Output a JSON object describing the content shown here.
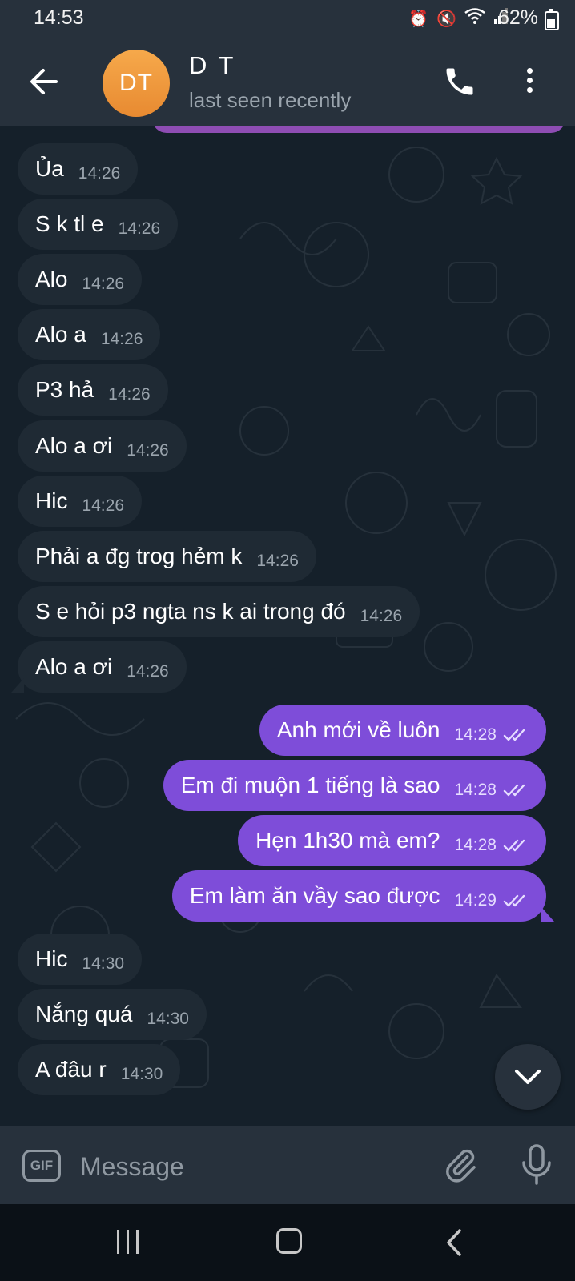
{
  "status_bar": {
    "time": "14:53",
    "battery": "62%"
  },
  "header": {
    "avatar_initials": "DT",
    "contact_name": "D T",
    "status": "last seen recently"
  },
  "messages": [
    {
      "dir": "in",
      "text": "Ủa",
      "time": "14:26"
    },
    {
      "dir": "in",
      "text": "S k tl e",
      "time": "14:26"
    },
    {
      "dir": "in",
      "text": "Alo",
      "time": "14:26"
    },
    {
      "dir": "in",
      "text": "Alo a",
      "time": "14:26"
    },
    {
      "dir": "in",
      "text": "P3 hả",
      "time": "14:26"
    },
    {
      "dir": "in",
      "text": "Alo a ơi",
      "time": "14:26"
    },
    {
      "dir": "in",
      "text": "Hic",
      "time": "14:26"
    },
    {
      "dir": "in",
      "text": "Phải a đg trog hẻm k",
      "time": "14:26"
    },
    {
      "dir": "in",
      "text": "S e hỏi p3 ngta ns k ai trong đó",
      "time": "14:26"
    },
    {
      "dir": "in",
      "text": "Alo a ơi",
      "time": "14:26"
    },
    {
      "dir": "out",
      "text": "Anh mới về luôn",
      "time": "14:28"
    },
    {
      "dir": "out",
      "text": "Em đi muộn 1 tiếng là sao",
      "time": "14:28"
    },
    {
      "dir": "out",
      "text": "Hẹn 1h30 mà em?",
      "time": "14:28"
    },
    {
      "dir": "out",
      "text": "Em làm ăn vầy sao được",
      "time": "14:29"
    },
    {
      "dir": "in",
      "text": "Hic",
      "time": "14:30"
    },
    {
      "dir": "in",
      "text": "Nắng quá",
      "time": "14:30"
    },
    {
      "dir": "in",
      "text": "A đâu r",
      "time": "14:30"
    }
  ],
  "input": {
    "gif_label": "GIF",
    "placeholder": "Message"
  },
  "colors": {
    "header_bg": "#27313c",
    "incoming_bubble": "#1f2a34",
    "outgoing_bubble": "#7e4dd9",
    "avatar": "#f0993d"
  },
  "icons": [
    "back-arrow-icon",
    "phone-icon",
    "more-vert-icon",
    "chevron-down-icon",
    "paperclip-icon",
    "microphone-icon"
  ]
}
